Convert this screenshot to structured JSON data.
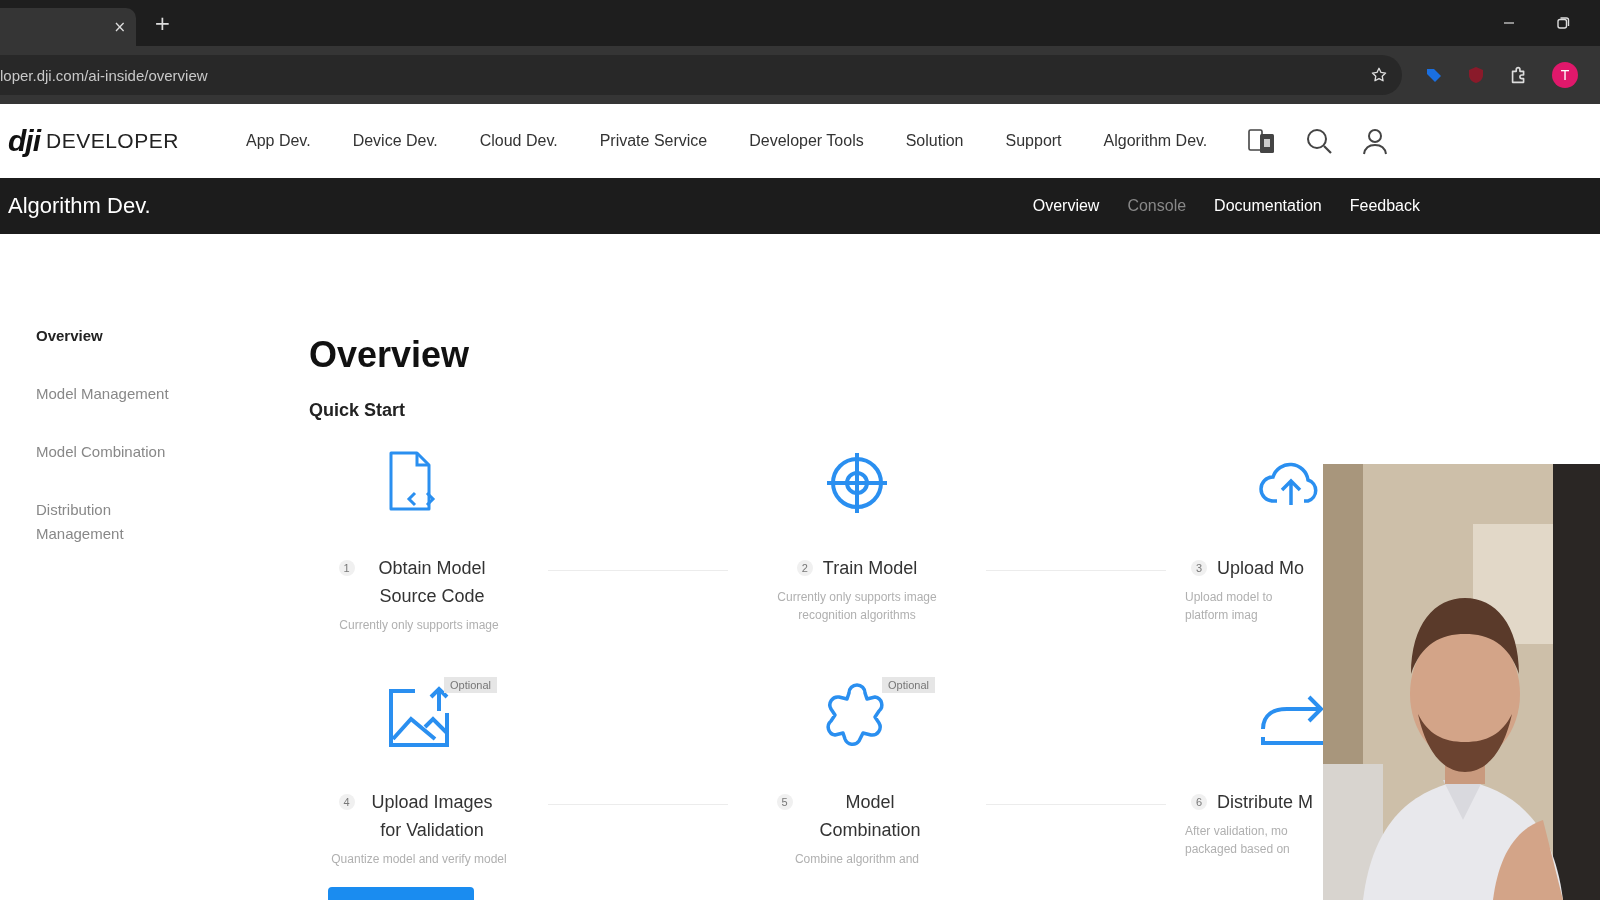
{
  "browser": {
    "tab": {
      "close": "×"
    },
    "new_tab": "+",
    "url": "loper.dji.com/ai-inside/overview",
    "profile": "T"
  },
  "header": {
    "logo": "dji",
    "brand": "DEVELOPER",
    "nav": [
      {
        "label": "App Dev."
      },
      {
        "label": "Device Dev."
      },
      {
        "label": "Cloud Dev."
      },
      {
        "label": "Private Service"
      },
      {
        "label": "Developer Tools"
      },
      {
        "label": "Solution"
      },
      {
        "label": "Support"
      },
      {
        "label": "Algorithm Dev."
      }
    ]
  },
  "subnav": {
    "title": "Algorithm Dev.",
    "links": [
      {
        "label": "Overview",
        "disabled": false
      },
      {
        "label": "Console",
        "disabled": true
      },
      {
        "label": "Documentation",
        "disabled": false
      },
      {
        "label": "Feedback",
        "disabled": false
      }
    ]
  },
  "sidebar": {
    "items": [
      {
        "label": "Overview",
        "selected": true
      },
      {
        "label": "Model Management",
        "selected": false
      },
      {
        "label": "Model Combination",
        "selected": false
      },
      {
        "label": "Distribution Management",
        "selected": false
      }
    ]
  },
  "page": {
    "title": "Overview",
    "section": "Quick Start",
    "steps": [
      {
        "kind": "code-file",
        "number": "1",
        "title": "Obtain Model Source Code",
        "description": [
          "Currently only supports image"
        ]
      },
      {
        "kind": "target",
        "number": "2",
        "title": "Train Model",
        "description": [
          "Currently only supports image",
          "recognition algorithms"
        ]
      },
      {
        "kind": "cloud-upload",
        "number": "3",
        "title": "Upload Mo",
        "description": [
          "Upload model to",
          "platform imag"
        ]
      },
      {
        "kind": "image-upload",
        "number": "4",
        "title": "Upload Images for Validation",
        "description": [
          "Quantize model and verify model"
        ],
        "badge": "Optional"
      },
      {
        "kind": "puzzle",
        "number": "5",
        "title": "Model Combination",
        "description": [
          "Combine algorithm and"
        ],
        "badge": "Optional"
      },
      {
        "kind": "share",
        "number": "6",
        "title": "Distribute M",
        "description": [
          "After validation, mo",
          "packaged based on"
        ]
      }
    ]
  }
}
